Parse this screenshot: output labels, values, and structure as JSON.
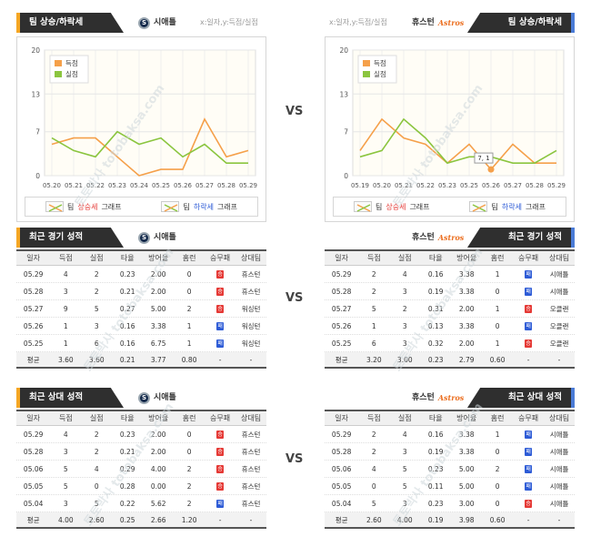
{
  "sections": {
    "trend_title": "팀 상승/하락세",
    "recent_title": "최근 경기 성적",
    "h2h_title": "최근 상대 성적",
    "vs_label": "VS"
  },
  "teams": {
    "home": "시애틀",
    "away": "휴스턴",
    "home_logo_text": "S",
    "away_logo_text": "Astros"
  },
  "chart_note": "x:일자,y:득점/실점",
  "legend": {
    "runs": "득점",
    "allowed": "실점",
    "up_pre": "팀 ",
    "up_word": "상승세",
    "up_post": " 그래프",
    "down_pre": "팀 ",
    "down_word": "하락세",
    "down_post": " 그래프"
  },
  "colors": {
    "runs": "#f5a04a",
    "allowed": "#8bc53f",
    "tab_left_accent": "#f5a623",
    "tab_right_accent": "#4a7bd6",
    "win": "#e53935",
    "lose": "#2d5bd6"
  },
  "chart_data": [
    {
      "type": "line",
      "team": "시애틀",
      "x": [
        "05.20",
        "05.21",
        "05.22",
        "05.23",
        "05.24",
        "05.25",
        "05.26",
        "05.27",
        "05.28",
        "05.29"
      ],
      "series": [
        {
          "name": "득점",
          "values": [
            5,
            6,
            6,
            3,
            0,
            1,
            1,
            9,
            3,
            4
          ]
        },
        {
          "name": "실점",
          "values": [
            6,
            4,
            3,
            7,
            5,
            6,
            3,
            5,
            2,
            2
          ]
        }
      ],
      "yticks": [
        0,
        7,
        13,
        20
      ],
      "ylim": [
        0,
        20
      ],
      "grid": true,
      "legend_position": "top-left"
    },
    {
      "type": "line",
      "team": "휴스턴",
      "x": [
        "05.19",
        "05.20",
        "05.21",
        "05.22",
        "05.23",
        "05.25",
        "05.26",
        "05.27",
        "05.28",
        "05.29"
      ],
      "series": [
        {
          "name": "득점",
          "values": [
            4,
            9,
            6,
            5,
            2,
            5,
            1,
            5,
            2,
            2
          ]
        },
        {
          "name": "실점",
          "values": [
            3,
            4,
            9,
            6,
            2,
            3,
            3,
            2,
            2,
            4
          ]
        }
      ],
      "yticks": [
        0,
        7,
        13,
        20
      ],
      "ylim": [
        0,
        20
      ],
      "grid": true,
      "legend_position": "top-left",
      "tooltip": "7, 1"
    }
  ],
  "table_headers": [
    "일자",
    "득점",
    "실점",
    "타율",
    "방어율",
    "홈런",
    "승무패",
    "상대팀"
  ],
  "recent_home": {
    "rows": [
      [
        "05.29",
        "4",
        "2",
        "0.23",
        "2.00",
        "0",
        "win",
        "휴스턴"
      ],
      [
        "05.28",
        "3",
        "2",
        "0.21",
        "2.00",
        "0",
        "win",
        "휴스턴"
      ],
      [
        "05.27",
        "9",
        "5",
        "0.27",
        "5.00",
        "2",
        "win",
        "워싱턴"
      ],
      [
        "05.26",
        "1",
        "3",
        "0.16",
        "3.38",
        "1",
        "lose",
        "워싱턴"
      ],
      [
        "05.25",
        "1",
        "6",
        "0.16",
        "6.75",
        "1",
        "lose",
        "워싱턴"
      ]
    ],
    "avg": [
      "평균",
      "3.60",
      "3.60",
      "0.21",
      "3.77",
      "0.80",
      "-",
      "-"
    ]
  },
  "recent_away": {
    "rows": [
      [
        "05.29",
        "2",
        "4",
        "0.16",
        "3.38",
        "1",
        "lose",
        "시애틀"
      ],
      [
        "05.28",
        "2",
        "3",
        "0.19",
        "3.38",
        "0",
        "lose",
        "시애틀"
      ],
      [
        "05.27",
        "5",
        "2",
        "0.31",
        "2.00",
        "1",
        "win",
        "오클랜"
      ],
      [
        "05.26",
        "1",
        "3",
        "0.13",
        "3.38",
        "0",
        "lose",
        "오클랜"
      ],
      [
        "05.25",
        "6",
        "3",
        "0.32",
        "2.00",
        "1",
        "win",
        "오클랜"
      ]
    ],
    "avg": [
      "평균",
      "3.20",
      "3.00",
      "0.23",
      "2.79",
      "0.60",
      "-",
      "-"
    ]
  },
  "h2h_home": {
    "rows": [
      [
        "05.29",
        "4",
        "2",
        "0.23",
        "2.00",
        "0",
        "win",
        "휴스턴"
      ],
      [
        "05.28",
        "3",
        "2",
        "0.21",
        "2.00",
        "0",
        "win",
        "휴스턴"
      ],
      [
        "05.06",
        "5",
        "4",
        "0.29",
        "4.00",
        "2",
        "win",
        "휴스턴"
      ],
      [
        "05.05",
        "5",
        "0",
        "0.28",
        "0.00",
        "2",
        "win",
        "휴스턴"
      ],
      [
        "05.04",
        "3",
        "5",
        "0.22",
        "5.62",
        "2",
        "lose",
        "휴스턴"
      ]
    ],
    "avg": [
      "평균",
      "4.00",
      "2.60",
      "0.25",
      "2.66",
      "1.20",
      "-",
      "-"
    ]
  },
  "h2h_away": {
    "rows": [
      [
        "05.29",
        "2",
        "4",
        "0.16",
        "3.38",
        "1",
        "lose",
        "시애틀"
      ],
      [
        "05.28",
        "2",
        "3",
        "0.19",
        "3.38",
        "0",
        "lose",
        "시애틀"
      ],
      [
        "05.06",
        "4",
        "5",
        "0.23",
        "5.00",
        "2",
        "lose",
        "시애틀"
      ],
      [
        "05.05",
        "0",
        "5",
        "0.11",
        "5.00",
        "0",
        "lose",
        "시애틀"
      ],
      [
        "05.04",
        "5",
        "3",
        "0.23",
        "3.00",
        "0",
        "win",
        "시애틀"
      ]
    ],
    "avg": [
      "평균",
      "2.60",
      "4.00",
      "0.19",
      "3.98",
      "0.60",
      "-",
      "-"
    ]
  },
  "result_labels": {
    "win": "승",
    "lose": "패"
  },
  "watermark": "토토박사 totobaksa.com"
}
